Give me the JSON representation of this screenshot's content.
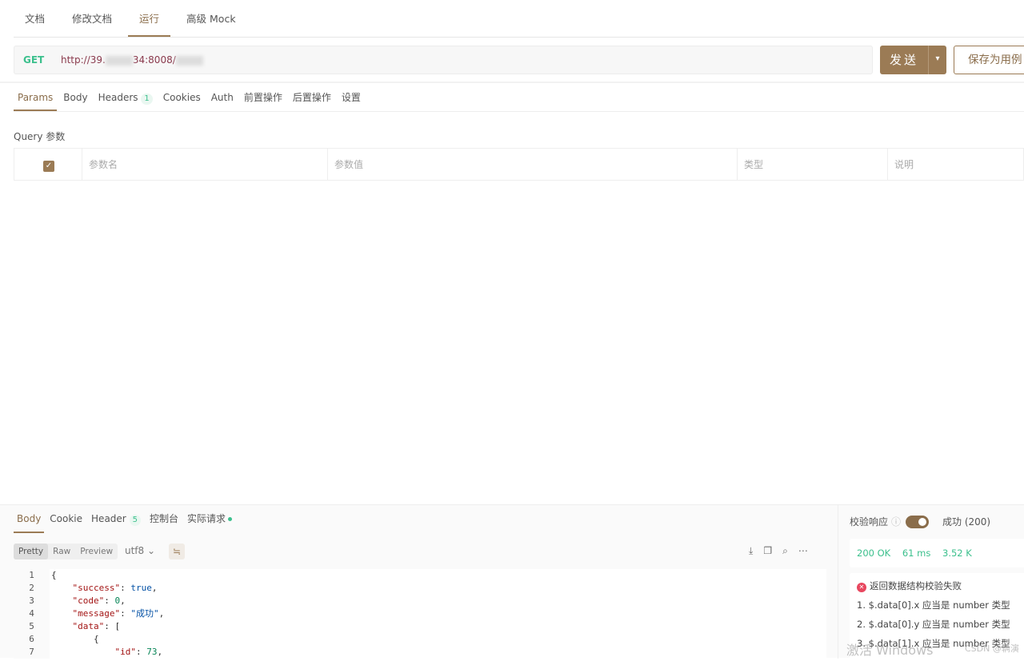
{
  "top_tabs": [
    "文档",
    "修改文档",
    "运行",
    "高级 Mock"
  ],
  "request": {
    "method": "GET",
    "url_prefix": "http://39.",
    "url_mid": "34:8008/",
    "send": "发送",
    "save": "保存为用例"
  },
  "req_tabs": [
    {
      "label": "Params"
    },
    {
      "label": "Body"
    },
    {
      "label": "Headers",
      "badge": "1"
    },
    {
      "label": "Cookies"
    },
    {
      "label": "Auth"
    },
    {
      "label": "前置操作"
    },
    {
      "label": "后置操作"
    },
    {
      "label": "设置"
    }
  ],
  "query": {
    "title": "Query 参数",
    "columns": [
      "参数名",
      "参数值",
      "类型",
      "说明"
    ]
  },
  "resp_tabs": [
    {
      "label": "Body"
    },
    {
      "label": "Cookie"
    },
    {
      "label": "Header",
      "badge": "5"
    },
    {
      "label": "控制台"
    },
    {
      "label": "实际请求"
    }
  ],
  "view_modes": [
    "Pretty",
    "Raw",
    "Preview"
  ],
  "encoding": "utf8",
  "code_lines": [
    [
      [
        "p",
        "{"
      ]
    ],
    [
      [
        "p",
        "    "
      ],
      [
        "k",
        "\"success\""
      ],
      [
        "p",
        ": "
      ],
      [
        "b",
        "true"
      ],
      [
        "p",
        ","
      ]
    ],
    [
      [
        "p",
        "    "
      ],
      [
        "k",
        "\"code\""
      ],
      [
        "p",
        ": "
      ],
      [
        "n",
        "0"
      ],
      [
        "p",
        ","
      ]
    ],
    [
      [
        "p",
        "    "
      ],
      [
        "k",
        "\"message\""
      ],
      [
        "p",
        ": "
      ],
      [
        "s",
        "\"成功\""
      ],
      [
        "p",
        ","
      ]
    ],
    [
      [
        "p",
        "    "
      ],
      [
        "k",
        "\"data\""
      ],
      [
        "p",
        ": ["
      ]
    ],
    [
      [
        "p",
        "        {"
      ]
    ],
    [
      [
        "p",
        "            "
      ],
      [
        "k",
        "\"id\""
      ],
      [
        "p",
        ": "
      ],
      [
        "n",
        "73"
      ],
      [
        "p",
        ","
      ]
    ]
  ],
  "validate": {
    "label": "校验响应",
    "result": "成功 (200)"
  },
  "status": {
    "code": "200 OK",
    "time": "61 ms",
    "size": "3.52 K"
  },
  "errors": {
    "title": "返回数据结构校验失败",
    "items": [
      "1. $.data[0].x 应当是 number 类型",
      "2. $.data[0].y 应当是 number 类型",
      "3. $.data[1].x 应当是 number 类型"
    ]
  },
  "watermark": {
    "windows": "激活 Windows",
    "csdn": "CSDN @辆演"
  }
}
